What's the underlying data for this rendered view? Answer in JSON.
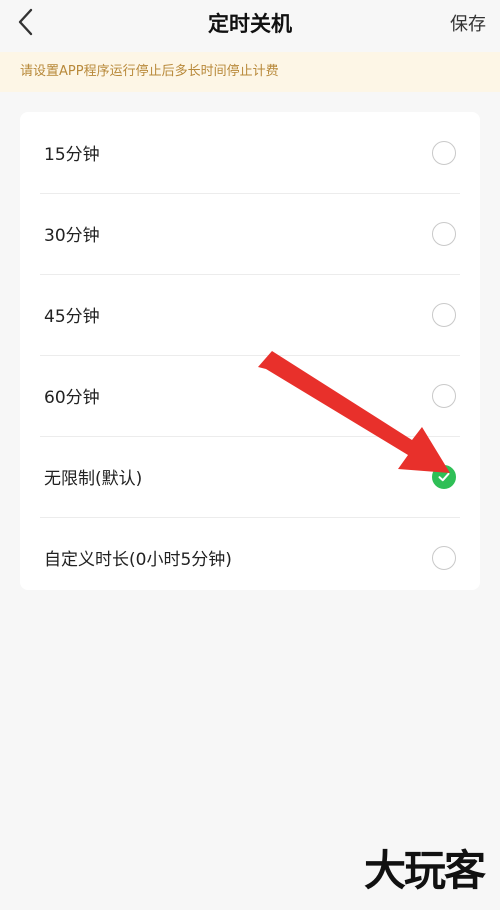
{
  "header": {
    "title": "定时关机",
    "save_label": "保存",
    "back_icon": "chevron-left-icon"
  },
  "notice": {
    "text": "请设置APP程序运行停止后多长时间停止计费"
  },
  "options": [
    {
      "label": "15分钟",
      "selected": false
    },
    {
      "label": "30分钟",
      "selected": false
    },
    {
      "label": "45分钟",
      "selected": false
    },
    {
      "label": "60分钟",
      "selected": false
    },
    {
      "label": "无限制(默认)",
      "selected": true
    },
    {
      "label": "自定义时长(0小时5分钟)",
      "selected": false
    }
  ],
  "colors": {
    "accent": "#2fbf56",
    "notice_bg": "#fdf6e6",
    "notice_text": "#b8893a",
    "annotation_arrow": "#e8302b"
  },
  "watermark": {
    "text": "大玩客"
  }
}
